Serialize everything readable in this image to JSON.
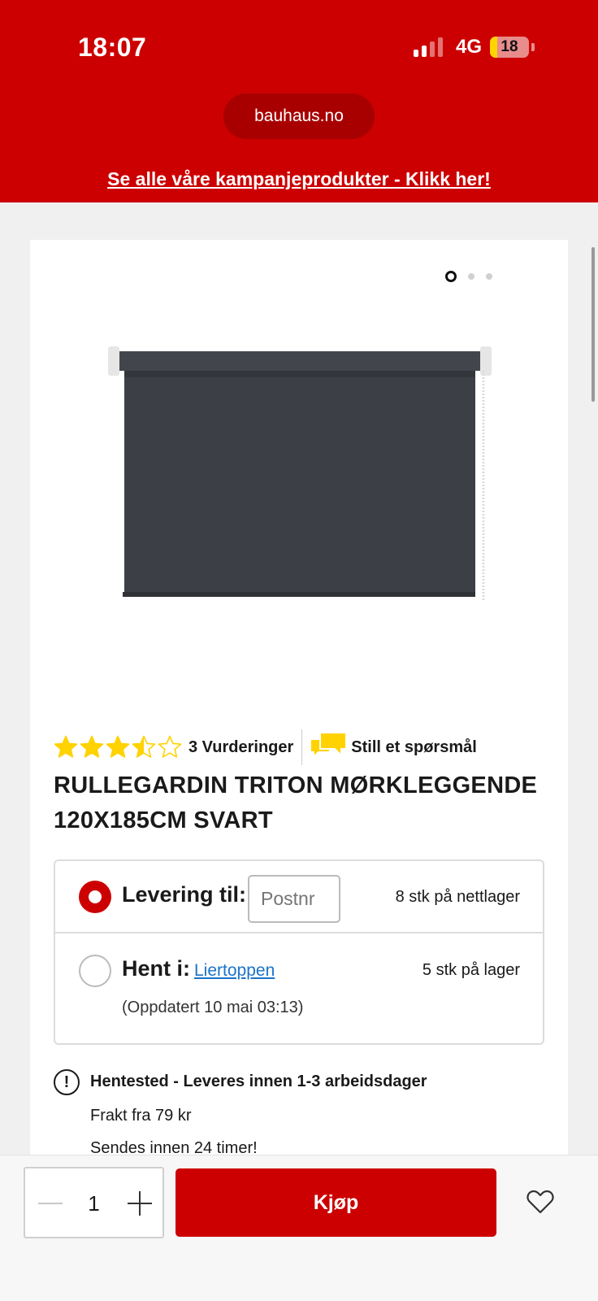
{
  "status_bar": {
    "time": "18:07",
    "network": "4G",
    "battery": "18",
    "battery_level": 0.18
  },
  "browser": {
    "url": "bauhaus.no"
  },
  "promo_banner": {
    "text": "Se alle våre kampanjeprodukter - Klikk her!"
  },
  "gallery": {
    "total_images": 3,
    "active_index": 0
  },
  "product": {
    "rating": 3.5,
    "rating_max": 5,
    "reviews_label": "3 Vurderinger",
    "ask_question_label": "Still et spørsmål",
    "title": "RULLEGARDIN TRITON MØRKLEGGENDE 120X185CM SVART"
  },
  "stock": {
    "delivery": {
      "label": "Levering til:",
      "postnr_placeholder": "Postnr",
      "qty_text": "8 stk på nettlager",
      "selected": true
    },
    "pickup": {
      "label": "Hent i:",
      "store": "Liertoppen",
      "qty_text": "5 stk på lager",
      "updated": "(Oppdatert 10 mai 03:13)",
      "selected": false
    }
  },
  "shipping_info": {
    "heading": "Hentested - Leveres innen 1-3 arbeidsdager",
    "freight": "Frakt fra 79 kr",
    "dispatch": "Sendes innen 24 timer!"
  },
  "purchase_bar": {
    "quantity": "1",
    "buy_label": "Kjøp"
  },
  "colors": {
    "brand_red": "#cc0000",
    "star_yellow": "#ffd200",
    "link_blue": "#1a73c8"
  }
}
